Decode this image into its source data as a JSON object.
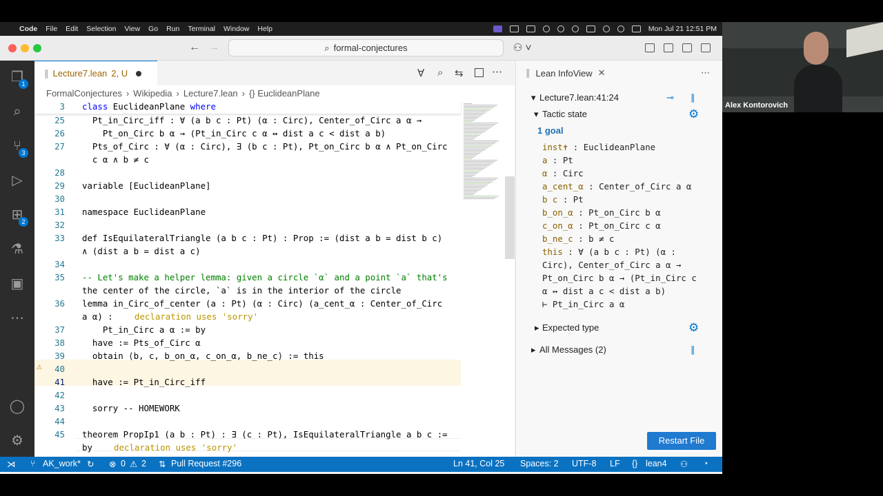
{
  "menubar": {
    "apple": "",
    "app": "Code",
    "items": [
      "File",
      "Edit",
      "Selection",
      "View",
      "Go",
      "Run",
      "Terminal",
      "Window",
      "Help"
    ],
    "datetime": "Mon Jul 21  12:51 PM"
  },
  "titlebar": {
    "search": "formal-conjectures"
  },
  "activity": {
    "badges": [
      "1",
      "3",
      "2"
    ]
  },
  "tab": {
    "label": "Lecture7.lean",
    "status": "2, U"
  },
  "breadcrumb": [
    "FormalConjectures",
    "Wikipedia",
    "Lecture7.lean",
    "{} EuclideanPlane"
  ],
  "code": {
    "sticky": {
      "num": "3",
      "text": "class EuclideanPlane where"
    },
    "lines": [
      {
        "num": "25",
        "text": "  Pt_in_Circ_iff : ∀ (a b c : Pt) (α : Circ), Center_of_Circ a α →"
      },
      {
        "num": "26",
        "text": "    Pt_on_Circ b α → (Pt_in_Circ c α ↔ dist a c < dist a b)"
      },
      {
        "num": "27",
        "text": "  Pts_of_Circ : ∀ (α : Circ), ∃ (b c : Pt), Pt_on_Circ b α ∧ Pt_on_Circ"
      },
      {
        "num": "",
        "text": "  c α ∧ b ≠ c"
      },
      {
        "num": "28",
        "text": ""
      },
      {
        "num": "29",
        "text": "variable [EuclideanPlane]"
      },
      {
        "num": "30",
        "text": ""
      },
      {
        "num": "31",
        "text": "namespace EuclideanPlane"
      },
      {
        "num": "32",
        "text": ""
      },
      {
        "num": "33",
        "text": "def IsEquilateralTriangle (a b c : Pt) : Prop := (dist a b = dist b c)"
      },
      {
        "num": "",
        "text": "∧ (dist a b = dist a c)"
      },
      {
        "num": "34",
        "text": ""
      },
      {
        "num": "35",
        "text": "-- Let's make a helper lemma: given a circle `α` and a point `a` that's"
      },
      {
        "num": "",
        "text": "the center of the circle, `a` is in the interior of the circle"
      },
      {
        "num": "36",
        "text": "lemma in_Circ_of_center (a : Pt) (α : Circ) (a_cent_α : Center_of_Circ"
      },
      {
        "num": "",
        "text": "a α) :"
      },
      {
        "num": "37",
        "text": "    Pt_in_Circ a α := by"
      },
      {
        "num": "38",
        "text": "  have := Pts_of_Circ α"
      },
      {
        "num": "39",
        "text": "  obtain ⟨b, c, b_on_α, c_on_α, b_ne_c⟩ := this"
      },
      {
        "num": "40",
        "text": ""
      },
      {
        "num": "41",
        "text": "  have := Pt_in_Circ_iff"
      },
      {
        "num": "42",
        "text": ""
      },
      {
        "num": "43",
        "text": "  sorry -- HOMEWORK"
      },
      {
        "num": "44",
        "text": ""
      },
      {
        "num": "45",
        "text": "theorem PropIp1 (a b : Pt) : ∃ (c : Pt), IsEquilateralTriangle a b c :="
      },
      {
        "num": "",
        "text": "by"
      }
    ],
    "hint1": "declaration uses 'sorry'",
    "hint2": "declaration uses 'sorry'"
  },
  "infoview": {
    "title": "Lean InfoView",
    "position": "Lecture7.lean:41:24",
    "tactic_state": "Tactic state",
    "goals": "1 goal",
    "hyps": [
      {
        "name": "inst✝",
        "type": " : EuclideanPlane"
      },
      {
        "name": "a",
        "type": " : Pt"
      },
      {
        "name": "α",
        "type": " : Circ"
      },
      {
        "name": "a_cent_α",
        "type": " : Center_of_Circ a α"
      },
      {
        "name": "b c",
        "type": " : Pt"
      },
      {
        "name": "b_on_α",
        "type": " : Pt_on_Circ b α"
      },
      {
        "name": "c_on_α",
        "type": " : Pt_on_Circ c α"
      },
      {
        "name": "b_ne_c",
        "type": " : b ≠ c"
      },
      {
        "name": "this",
        "type": " : ∀ (a b c : Pt) (α :"
      },
      {
        "name": "",
        "type": "Circ), Center_of_Circ a α →"
      },
      {
        "name": "",
        "type": "Pt_on_Circ b α → (Pt_in_Circ c"
      },
      {
        "name": "",
        "type": "α ↔ dist a c < dist a b)"
      },
      {
        "name": "",
        "type": "⊢ Pt_in_Circ a α"
      }
    ],
    "expected_type": "Expected type",
    "all_messages": "All Messages (2)",
    "restart": "Restart File"
  },
  "status": {
    "branch": "AK_work*",
    "errors": "0",
    "warnings": "2",
    "pr": "Pull Request #296",
    "cursor": "Ln 41, Col 25",
    "spaces": "Spaces: 2",
    "encoding": "UTF-8",
    "eol": "LF",
    "lang": "lean4"
  },
  "webcam": {
    "name": "Alex Kontorovich"
  }
}
